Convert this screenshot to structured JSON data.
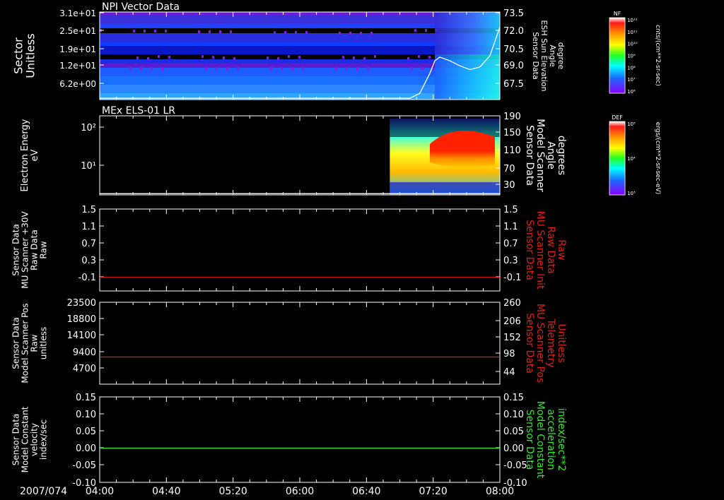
{
  "date_label": "2007/074",
  "time_ticks": [
    "04:00",
    "04:40",
    "05:20",
    "06:00",
    "06:40",
    "07:20",
    "08:00"
  ],
  "chart_data": [
    {
      "type": "heatmap",
      "title": "NPI Vector Data",
      "ylabel": [
        "Sector",
        "Unitless"
      ],
      "yticks": [
        "3.1e+01",
        "2.5e+01",
        "1.9e+01",
        "1.2e+01",
        "6.2e+00"
      ],
      "right_label": [
        "Sensor Data",
        "ESH Sun Elevation",
        "Angle",
        "degree"
      ],
      "right_ticks": [
        "73.5",
        "72.0",
        "70.5",
        "69.0",
        "67.5"
      ],
      "right_ylim": [
        66.5,
        73.5
      ],
      "overlay_series": {
        "x_hours": [
          4.0,
          7.1,
          7.2,
          7.3,
          7.35,
          7.4,
          7.5,
          7.6,
          7.7,
          7.8,
          7.9,
          8.0
        ],
        "values": [
          66.6,
          66.6,
          67.0,
          68.6,
          69.6,
          69.9,
          69.6,
          69.2,
          68.9,
          69.1,
          70.0,
          72.3
        ]
      },
      "colorbar": {
        "title": "NF",
        "unit": "cnts/(cm**2-sr-sec)",
        "ticks": [
          "10¹²",
          "10¹¹",
          "10¹⁰",
          "10⁹",
          "10⁸",
          "10⁷",
          "10⁶"
        ]
      }
    },
    {
      "type": "heatmap",
      "title": "MEx ELS-01 LR",
      "ylabel": [
        "Electron Energy",
        "eV"
      ],
      "yticks": [
        "10²",
        "10¹"
      ],
      "right_label": [
        "Sensor Data",
        "Model Scanner",
        "Angle",
        "degrees"
      ],
      "right_ticks": [
        "190",
        "150",
        "110",
        "70",
        "30"
      ],
      "right_ylim": [
        0,
        190
      ],
      "overlay_series": {
        "x_hours": [
          4.0,
          8.0
        ],
        "values": [
          3,
          3
        ]
      },
      "data_extent_hours": [
        6.9,
        8.0
      ],
      "colorbar": {
        "title": "DEF",
        "unit": "ergs/(cm**2-sr-sec-eV)",
        "ticks": [
          "10⁵",
          "10⁴",
          "10³"
        ]
      }
    },
    {
      "type": "line",
      "ylabel": [
        "Sensor Data",
        "MU Scanner +30V",
        "Raw Data",
        "Raw"
      ],
      "yticks": [
        "1.5",
        "1.1",
        "0.7",
        "0.3",
        "-0.1"
      ],
      "ylim": [
        -0.3,
        1.5
      ],
      "right_label": [
        "Sensor Data",
        "MU Scanner Init",
        "Raw Data",
        "Raw"
      ],
      "right_ticks": [
        "1.5",
        "1.1",
        "0.7",
        "0.3",
        "-0.1"
      ],
      "series": [
        {
          "x_hours": [
            4.0,
            8.0
          ],
          "values": [
            0.0,
            0.0
          ],
          "color": "#e41a1a"
        }
      ],
      "right_color": "#e41a1a"
    },
    {
      "type": "line",
      "ylabel": [
        "Sensor Data",
        "Model Scanner Pos",
        "Raw",
        "unitless"
      ],
      "yticks": [
        "23500",
        "18800",
        "14100",
        "9400",
        "4700"
      ],
      "ylim": [
        0,
        23500
      ],
      "right_label": [
        "Sensor Data",
        "MU Scanner Pos",
        "Telemetry",
        "Unitless"
      ],
      "right_ticks": [
        "260",
        "206",
        "152",
        "98",
        "44"
      ],
      "series": [
        {
          "x_hours": [
            4.0,
            8.0
          ],
          "values": [
            7800,
            7800
          ],
          "color": "#e41a1a"
        }
      ],
      "right_color": "#e41a1a"
    },
    {
      "type": "line",
      "ylabel": [
        "Sensor Data",
        "Model Constant",
        "velocity",
        "index/sec"
      ],
      "yticks": [
        "0.15",
        "0.10",
        "0.05",
        "0.00",
        "-0.05",
        "-0.10"
      ],
      "ylim": [
        -0.1,
        0.15
      ],
      "right_label": [
        "Sensor Data",
        "Model Constant",
        "acceleration",
        "index/sec**2"
      ],
      "right_ticks": [
        "0.15",
        "0.10",
        "0.05",
        "0.00",
        "-0.05",
        "-0.10"
      ],
      "series": [
        {
          "x_hours": [
            4.0,
            8.0
          ],
          "values": [
            0.0,
            0.0
          ],
          "color": "#2ee82e"
        }
      ],
      "right_color": "#2ee82e"
    }
  ]
}
